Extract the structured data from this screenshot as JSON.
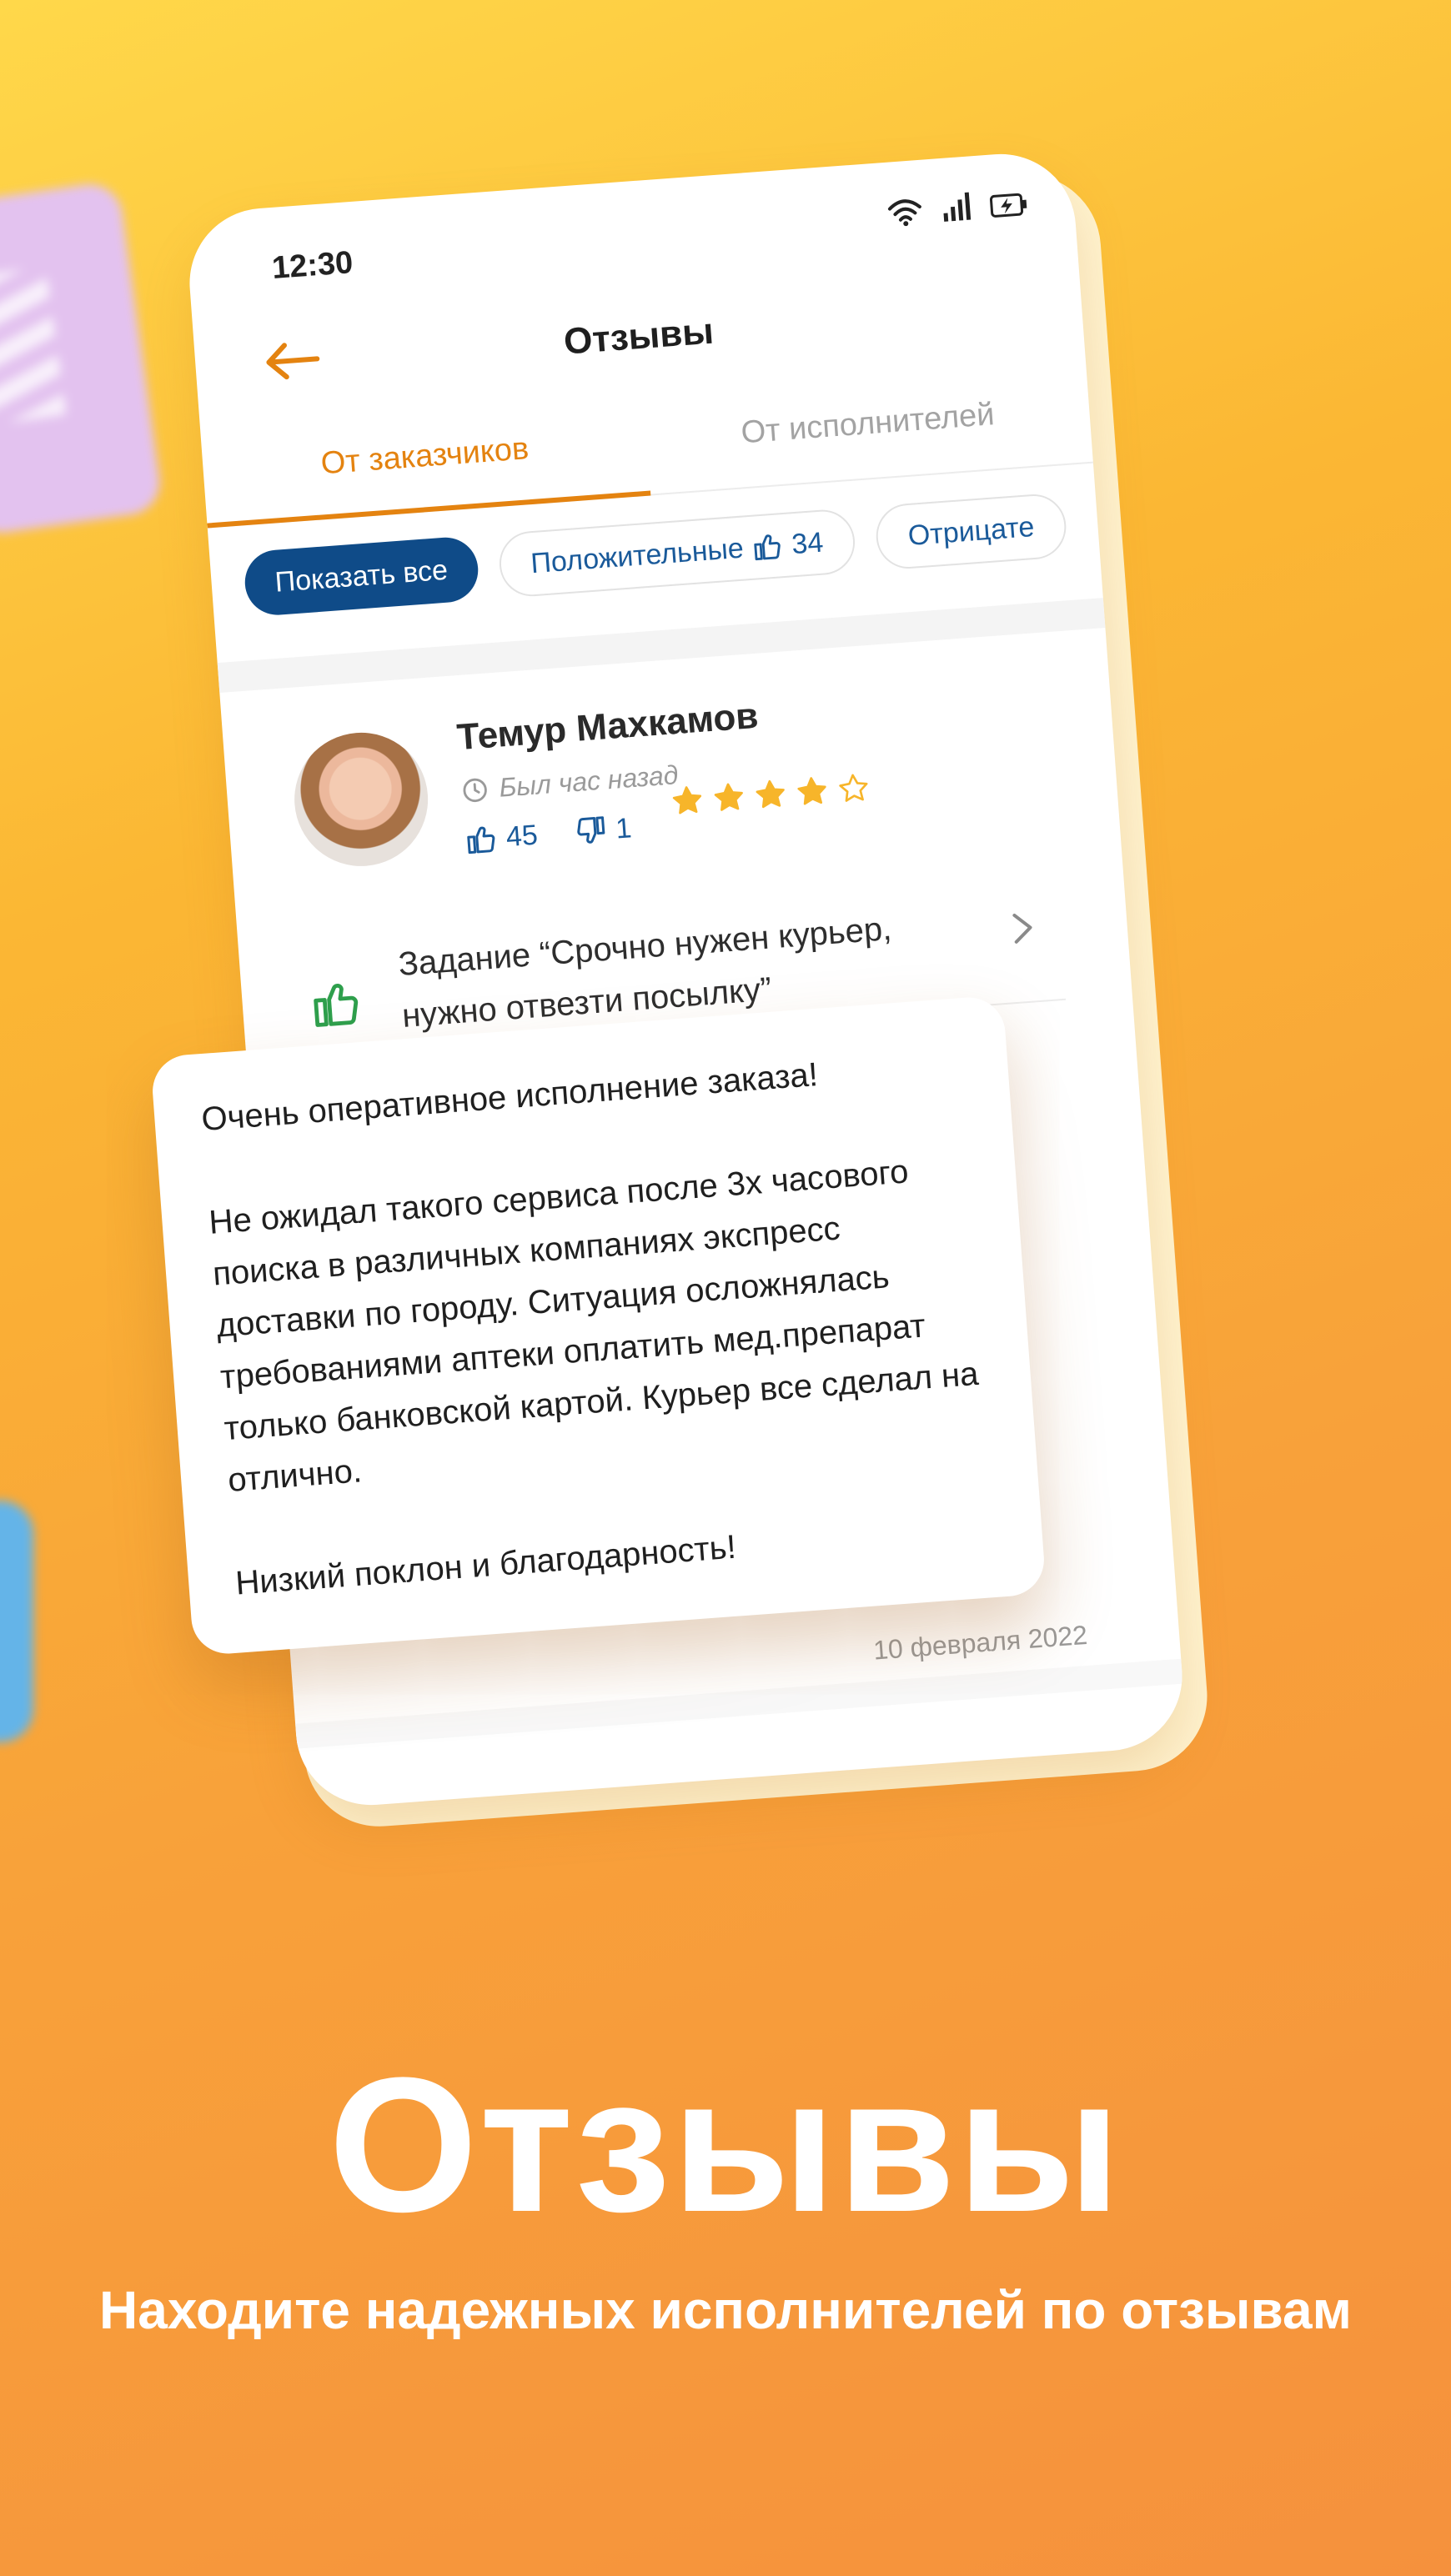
{
  "status_bar": {
    "time": "12:30"
  },
  "header": {
    "title": "Отзывы"
  },
  "tabs": [
    {
      "label": "От заказчиков",
      "active": true
    },
    {
      "label": "От исполнителей",
      "active": false
    }
  ],
  "filters": {
    "show_all": "Показать все",
    "positive_label": "Положительные",
    "positive_count": "34",
    "negative_label": "Отрицате"
  },
  "review": {
    "user_name": "Темур Махкамов",
    "last_seen": "Был час назад",
    "likes": "45",
    "dislikes": "1",
    "rating": 4,
    "rating_max": 5,
    "task_title": "Задание “Срочно нужен курьер, нужно отвезти посылку”",
    "text": "Очень оперативное исполнение заказа!\n\nНе ожидал такого сервиса после 3х часового поиска в различных компаниях экспресс доставки по городу. Ситуация осложнялась требованиями аптеки оплатить мед.препарат только банковской картой. Курьер все сделал на отлично.\n\nНизкий поклон и благодарность!",
    "date": "10 февраля 2022"
  },
  "promo": {
    "headline": "Отзывы",
    "subline": "Находите надежных исполнителей по отзывам"
  },
  "colors": {
    "accent_orange": "#e48310",
    "primary_blue": "#0f4b88",
    "link_blue": "#1a5a9a",
    "star_yellow": "#f7b52a",
    "positive_green": "#2e9f4c"
  }
}
